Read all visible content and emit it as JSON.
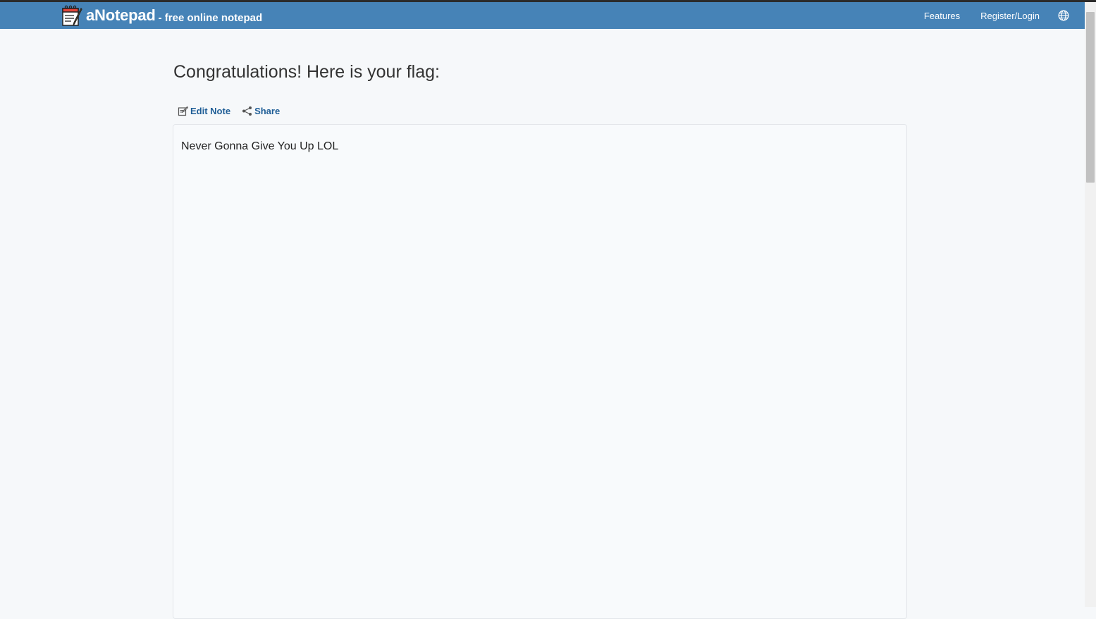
{
  "header": {
    "brand_name": "aNotepad",
    "brand_tagline": "- free online notepad",
    "nav": {
      "features": "Features",
      "register_login": "Register/Login"
    },
    "language_icon": "globe-icon"
  },
  "main": {
    "title": "Congratulations! Here is your flag:",
    "actions": {
      "edit_note": "Edit Note",
      "share": "Share"
    },
    "note_text": "Never Gonna Give You Up LOL"
  },
  "colors": {
    "navbar": "#4683b7",
    "link": "#1e5d96",
    "page_background": "#f6f8fa"
  }
}
